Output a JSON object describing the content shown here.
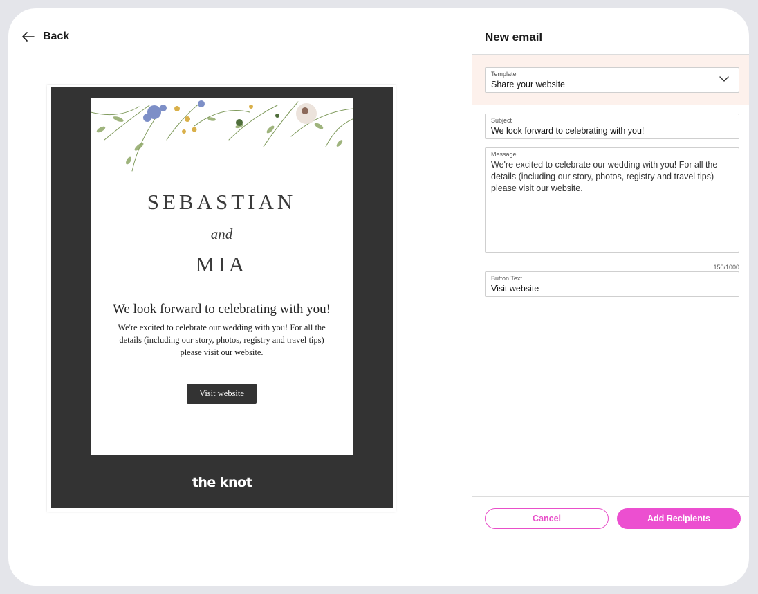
{
  "header": {
    "back_label": "Back",
    "panel_title": "New email"
  },
  "preview": {
    "name_one": "SEBASTIAN",
    "and_text": "and",
    "name_two": "MIA",
    "heading": "We look forward to celebrating with you!",
    "body": "We're excited to celebrate our wedding with you! For all the details (including our story, photos, registry and travel tips) please visit our website.",
    "cta": "Visit website",
    "brand": "the knot"
  },
  "form": {
    "template": {
      "label": "Template",
      "value": "Share your website"
    },
    "subject": {
      "label": "Subject",
      "value": "We look forward to celebrating with you!"
    },
    "message": {
      "label": "Message",
      "value": "We're excited to celebrate our wedding with you! For all the details (including our story, photos, registry and travel tips) please visit our website.",
      "char_count": "150/1000"
    },
    "button_text": {
      "label": "Button Text",
      "value": "Visit website"
    }
  },
  "actions": {
    "cancel_label": "Cancel",
    "add_label": "Add Recipients"
  },
  "colors": {
    "accent": "#ec4fd0",
    "template_band": "#fdf1ec",
    "preview_dark": "#333333"
  }
}
